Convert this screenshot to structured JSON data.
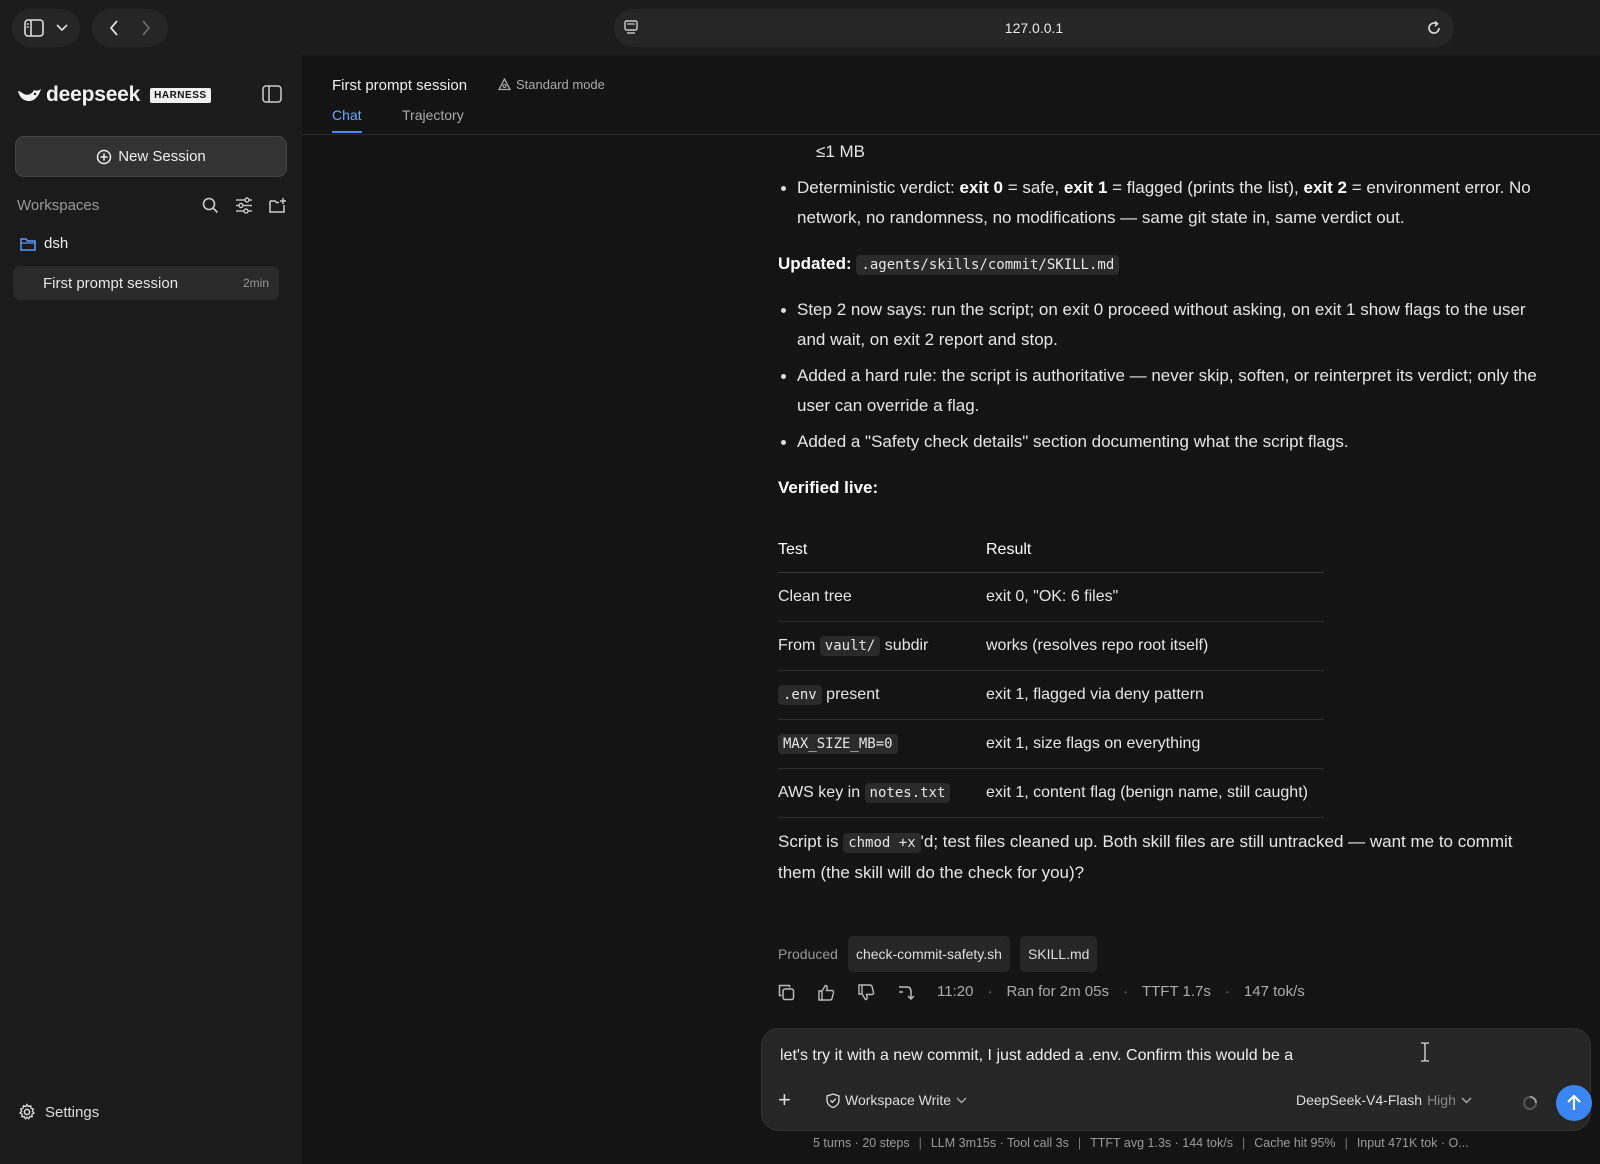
{
  "browser": {
    "url": "127.0.0.1"
  },
  "sidebar": {
    "brand_name": "deepseek",
    "brand_badge": "HARNESS",
    "new_session_label": "New Session",
    "workspaces_label": "Workspaces",
    "workspace": {
      "name": "dsh",
      "sessions": [
        {
          "title": "First prompt session",
          "age": "2min"
        }
      ]
    },
    "settings_label": "Settings"
  },
  "header": {
    "title": "First prompt session",
    "mode": "Standard mode",
    "tabs": [
      {
        "label": "Chat",
        "active": true
      },
      {
        "label": "Trajectory",
        "active": false
      }
    ]
  },
  "message": {
    "partial_top": "≤1 MB",
    "verdict_bullet": {
      "lead": "Deterministic verdict: ",
      "exit0": "exit 0",
      "exit0_text": " = safe, ",
      "exit1": "exit 1",
      "exit1_text": " = flagged (prints the list), ",
      "exit2": "exit 2",
      "exit2_text": " = environment error. No",
      "line2": "network, no randomness, no modifications — same git state in, same verdict out."
    },
    "updated_label": "Updated:",
    "updated_path": ".agents/skills/commit/SKILL.md",
    "updates": [
      {
        "l1": "Step 2 now says: run the script; on exit 0 proceed without asking, on exit 1 show flags to the user",
        "l2": "and wait, on exit 2 report and stop."
      },
      {
        "l1": "Added a hard rule: the script is authoritative — never skip, soften, or reinterpret its verdict; only the",
        "l2": "user can override a flag."
      },
      {
        "l1": "Added a \"Safety check details\" section documenting what the script flags.",
        "l2": ""
      }
    ],
    "verified_label": "Verified live:",
    "table": {
      "headers": [
        "Test",
        "Result"
      ],
      "rows": [
        {
          "test_pre": "Clean tree",
          "test_code": "",
          "test_post": "",
          "result": "exit 0, \"OK: 6 files\""
        },
        {
          "test_pre": "From ",
          "test_code": "vault/",
          "test_post": " subdir",
          "result": "works (resolves repo root itself)"
        },
        {
          "test_pre": "",
          "test_code": ".env",
          "test_post": " present",
          "result": "exit 1, flagged via deny pattern"
        },
        {
          "test_pre": "",
          "test_code": "MAX_SIZE_MB=0",
          "test_post": "",
          "result": "exit 1, size flags on everything"
        },
        {
          "test_pre": "AWS key in ",
          "test_code": "notes.txt",
          "test_post": "",
          "result": "exit 1, content flag (benign name, still caught)"
        }
      ]
    },
    "closing": {
      "pre": "Script is ",
      "code": "chmod +x",
      "post": "'d; test files cleaned up. Both skill files are still untracked — want me to commit",
      "line2": "them (the skill will do the check for you)?"
    },
    "produced_label": "Produced",
    "produced_files": [
      "check-commit-safety.sh",
      "SKILL.md"
    ],
    "meta": {
      "time": "11:20",
      "ran": "Ran for 2m 05s",
      "ttft": "TTFT 1.7s",
      "rate": "147 tok/s"
    }
  },
  "composer": {
    "input_value": "let's try it with a new commit, I just added a .env. Confirm this would be a",
    "plus_label": "+",
    "permission": "Workspace Write",
    "model": "DeepSeek-V4-Flash",
    "effort": "High"
  },
  "status": {
    "items": [
      "5 turns · 20 steps",
      "LLM 3m15s · Tool call 3s",
      "TTFT avg 1.3s · 144 tok/s",
      "Cache hit 95%",
      "Input 471K tok · O..."
    ]
  },
  "colors": {
    "accent": "#3b86f5",
    "tab_active": "#6fa8ff",
    "background": "#141414",
    "sidebar": "#1b1b1b"
  }
}
